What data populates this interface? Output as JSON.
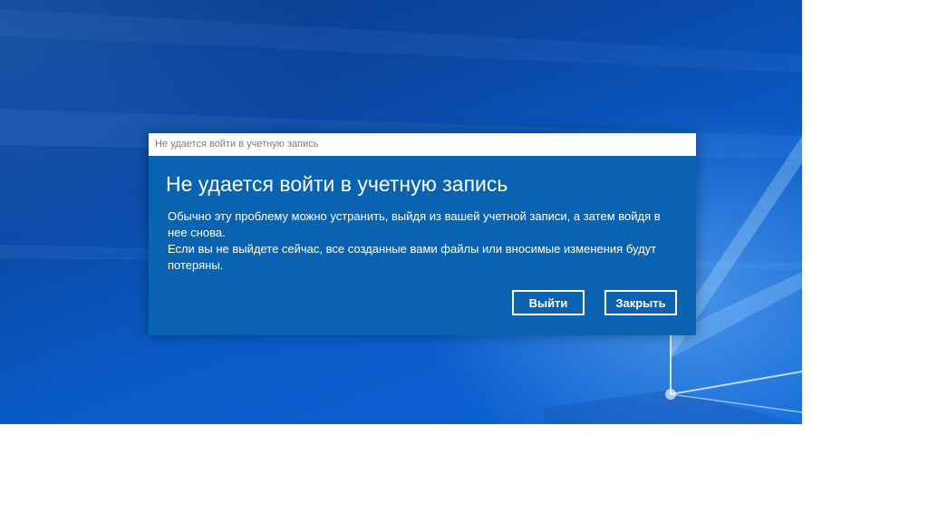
{
  "dialog": {
    "window_title": "Не удается войти в учетную запись",
    "heading": "Не удается войти в учетную запись",
    "message_line1": "Обычно эту проблему можно устранить, выйдя из вашей учетной записи, а затем войдя в нее снова.",
    "message_line2": "Если вы не выйдете сейчас, все созданные вами файлы или вносимые изменения будут потеряны.",
    "sign_out_label": "Выйти",
    "close_label": "Закрыть"
  },
  "colors": {
    "dialog_background": "#0a63b0",
    "desktop_background": "#0a5bc8",
    "titlebar_background": "#ffffff",
    "text": "#ffffff"
  }
}
